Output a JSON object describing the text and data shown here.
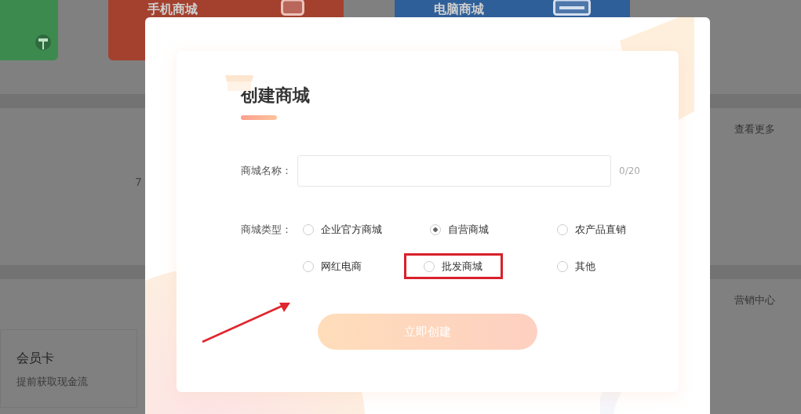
{
  "background": {
    "top_cards": [
      {
        "title": "手机商城",
        "kind": "mobile"
      },
      {
        "title": "电脑商城",
        "kind": "desktop"
      }
    ],
    "stats_section": {
      "text": "7",
      "link": "查看更多"
    },
    "marketing_section": {
      "link": "营销中心",
      "card": {
        "title": "会员卡",
        "subtitle": "提前获取现金流"
      }
    }
  },
  "dialog": {
    "title": "创建商城",
    "name_field": {
      "label": "商城名称：",
      "counter": "0/20"
    },
    "type_field": {
      "label": "商城类型：",
      "options": [
        {
          "label": "企业官方商城",
          "selected": false,
          "highlighted": false
        },
        {
          "label": "自营商城",
          "selected": true,
          "highlighted": false
        },
        {
          "label": "农产品直销",
          "selected": false,
          "highlighted": false
        },
        {
          "label": "网红电商",
          "selected": false,
          "highlighted": false
        },
        {
          "label": "批发商城",
          "selected": false,
          "highlighted": true
        },
        {
          "label": "其他",
          "selected": false,
          "highlighted": false
        }
      ]
    },
    "submit": {
      "label": "立即创建",
      "disabled": true
    }
  }
}
